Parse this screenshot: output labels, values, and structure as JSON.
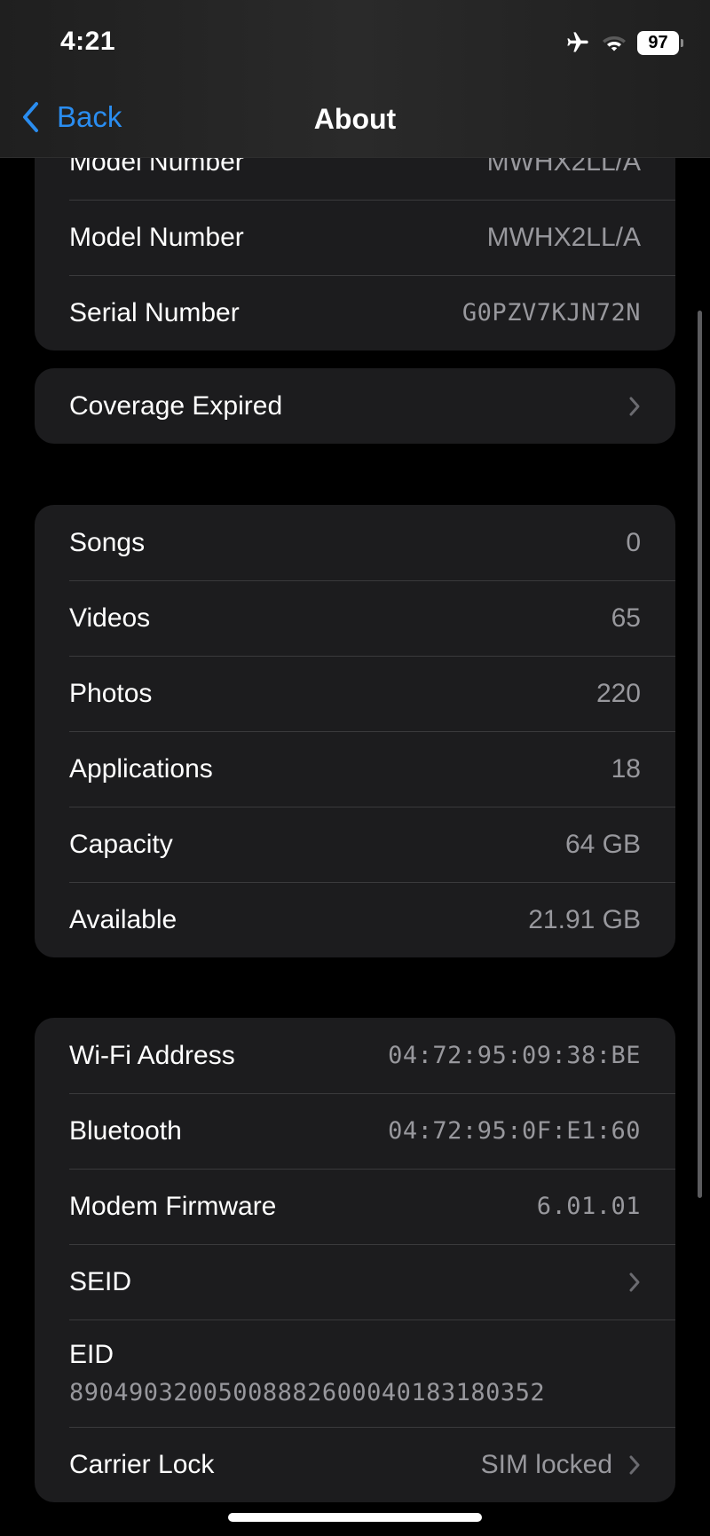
{
  "status_bar": {
    "time": "4:21",
    "icons": [
      "airplane-icon",
      "wifi-icon",
      "battery-icon"
    ],
    "battery_level": "97"
  },
  "nav": {
    "back_label": "Back",
    "title": "About",
    "accent_color": "#2a8df0"
  },
  "device_info": {
    "rows": [
      {
        "label": "Model Number",
        "value": "MWHX2LL/A"
      },
      {
        "label": "Serial Number",
        "value": "G0PZV7KJN72N"
      }
    ]
  },
  "coverage": {
    "label": "Coverage Expired"
  },
  "media": {
    "rows": [
      {
        "label": "Songs",
        "value": "0"
      },
      {
        "label": "Videos",
        "value": "65"
      },
      {
        "label": "Photos",
        "value": "220"
      },
      {
        "label": "Applications",
        "value": "18"
      },
      {
        "label": "Capacity",
        "value": "64 GB"
      },
      {
        "label": "Available",
        "value": "21.91 GB"
      }
    ]
  },
  "network": {
    "wifi": {
      "label": "Wi-Fi Address",
      "value": "04:72:95:09:38:BE"
    },
    "bluetooth": {
      "label": "Bluetooth",
      "value": "04:72:95:0F:E1:60"
    },
    "modem": {
      "label": "Modem Firmware",
      "value": "6.01.01"
    },
    "seid": {
      "label": "SEID"
    },
    "eid": {
      "label": "EID",
      "value": "89049032005008882600040183180352"
    },
    "carrier": {
      "label": "Carrier Lock",
      "value": "SIM locked"
    }
  }
}
